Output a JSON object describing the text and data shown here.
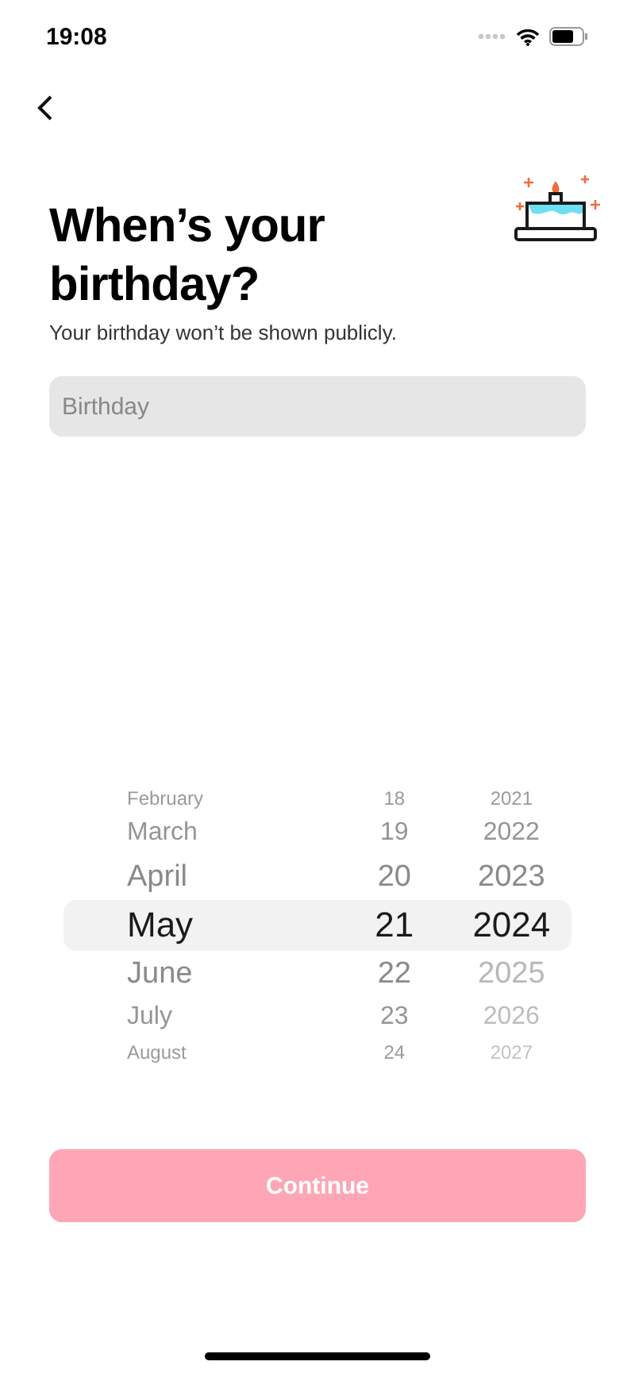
{
  "status_bar": {
    "time": "19:08"
  },
  "title": "When’s your birthday?",
  "subtitle": "Your birthday won’t be shown publicly.",
  "birthday_field": {
    "placeholder": "Birthday"
  },
  "picker": {
    "rows": [
      {
        "month": "February",
        "day": "18",
        "year": "2021",
        "selected": false,
        "year_disabled": false
      },
      {
        "month": "March",
        "day": "19",
        "year": "2022",
        "selected": false,
        "year_disabled": false
      },
      {
        "month": "April",
        "day": "20",
        "year": "2023",
        "selected": false,
        "year_disabled": false
      },
      {
        "month": "May",
        "day": "21",
        "year": "2024",
        "selected": true,
        "year_disabled": false
      },
      {
        "month": "June",
        "day": "22",
        "year": "2025",
        "selected": false,
        "year_disabled": true
      },
      {
        "month": "July",
        "day": "23",
        "year": "2026",
        "selected": false,
        "year_disabled": true
      },
      {
        "month": "August",
        "day": "24",
        "year": "2027",
        "selected": false,
        "year_disabled": true
      }
    ]
  },
  "continue_button": {
    "label": "Continue",
    "disabled": true
  }
}
